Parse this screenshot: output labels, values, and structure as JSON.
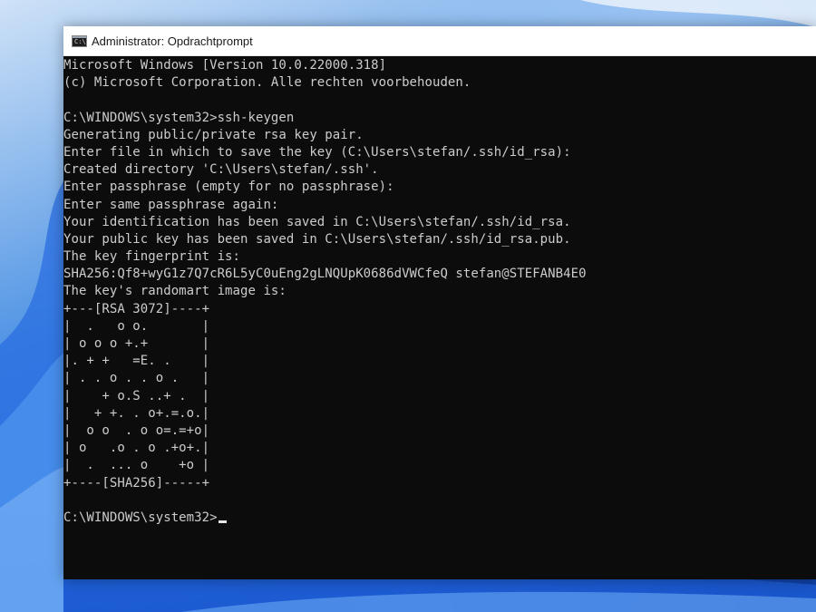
{
  "window": {
    "title": "Administrator: Opdrachtprompt",
    "icon": "cmd-icon",
    "icon_glyph": "C:\\"
  },
  "console": {
    "lines": [
      "Microsoft Windows [Version 10.0.22000.318]",
      "(c) Microsoft Corporation. Alle rechten voorbehouden.",
      "",
      "C:\\WINDOWS\\system32>ssh-keygen",
      "Generating public/private rsa key pair.",
      "Enter file in which to save the key (C:\\Users\\stefan/.ssh/id_rsa):",
      "Created directory 'C:\\Users\\stefan/.ssh'.",
      "Enter passphrase (empty for no passphrase):",
      "Enter same passphrase again:",
      "Your identification has been saved in C:\\Users\\stefan/.ssh/id_rsa.",
      "Your public key has been saved in C:\\Users\\stefan/.ssh/id_rsa.pub.",
      "The key fingerprint is:",
      "SHA256:Qf8+wyG1z7Q7cR6L5yC0uEng2gLNQUpK0686dVWCfeQ stefan@STEFANB4E0",
      "The key's randomart image is:",
      "+---[RSA 3072]----+",
      "|  .   o o.       |",
      "| o o o +.+       |",
      "|. + +   =E. .    |",
      "| . . o . . o .   |",
      "|    + o.S ..+ .  |",
      "|   + +. . o+.=.o.|",
      "|  o o  . o o=.=+o|",
      "| o   .o . o .+o+.|",
      "|  .  ... o    +o |",
      "+----[SHA256]-----+",
      ""
    ],
    "prompt": "C:\\WINDOWS\\system32>"
  }
}
